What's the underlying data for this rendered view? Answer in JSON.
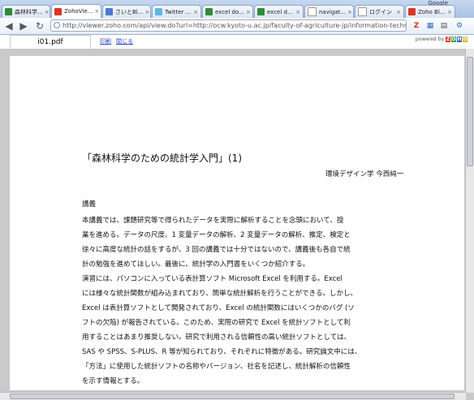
{
  "browser": {
    "window_label": "Google",
    "tabs": [
      {
        "label": "森林科学...",
        "icon": "spreadsheet-icon",
        "color": "#2e8b3a"
      },
      {
        "label": "ZohoVie...",
        "icon": "zoho-icon",
        "color": "#d9352b",
        "active": true
      },
      {
        "label": "さいとBl...",
        "icon": "blog-icon",
        "color": "#4a7bd0"
      },
      {
        "label": "Twitter ...",
        "icon": "twitter-icon",
        "color": "#5bb7e6"
      },
      {
        "label": "excel do...",
        "icon": "spreadsheet-icon",
        "color": "#2e8b3a"
      },
      {
        "label": "excel d...",
        "icon": "spreadsheet-icon",
        "color": "#2e8b3a"
      },
      {
        "label": "navigat...",
        "icon": "page-icon",
        "color": "#ffffff"
      },
      {
        "label": "ログイン",
        "icon": "page-icon",
        "color": "#ffffff"
      },
      {
        "label": "Zoho Bl...",
        "icon": "zoho-icon",
        "color": "#d9352b"
      }
    ],
    "url": "http://viewer.zoho.com/api/view.do?url=http://ocw.kyoto-u.ac.jp/faculty-of-agriculture-jp/information-technolo"
  },
  "viewer": {
    "doc_tab": "i01.pdf",
    "links": [
      "印刷",
      "閉じる"
    ],
    "powered_by": "powered by",
    "zoho_letters": [
      {
        "ch": "Z",
        "color": "#d9352b"
      },
      {
        "ch": "O",
        "color": "#3aa43a"
      },
      {
        "ch": "H",
        "color": "#2a68c8"
      },
      {
        "ch": "O",
        "color": "#e8b020"
      }
    ]
  },
  "document": {
    "title": "「森林科学のための統計学入門」(1)",
    "author": "環境デザイン学 今西純一",
    "heading": "講義",
    "lines": [
      "本講義では、課題研究等で得られたデータを実際に解析することを念頭において、授",
      "業を進める。データの尺度、1 変量データの解析、2 変量データの解析、推定、検定と",
      "徐々に高度な統計の話をするが、3 回の講義では十分ではないので、講義後も各自で統",
      "計の勉強を進めてほしい。最後に、統計学の入門書をいくつか紹介する。",
      "演習には、パソコンに入っている表計算ソフト                  Microsoft Excel を利用する。Excel",
      "には様々な統計関数が組み込まれており、簡単な統計解析を行うことができる。しかし、",
      "Excel は表計算ソフトとして開発されており、Excel の統計関数にはいくつかのバグ (ソ",
      "フトの欠陥) が報告されている。このため、実際の研究で                  Excel を統計ソフトとして利",
      "用することはあまり推奨しない。研究で利用される信頼性の高い統計ソフトとしては、",
      "SAS や SPSS、S-PLUS、R 等が知られており、それぞれに特徴がある。研究論文中には、",
      "「方法」に使用した統計ソフトの名称やバージョン、社名を記述し、統計解析の信頼性",
      "を示す情報とする。"
    ]
  }
}
